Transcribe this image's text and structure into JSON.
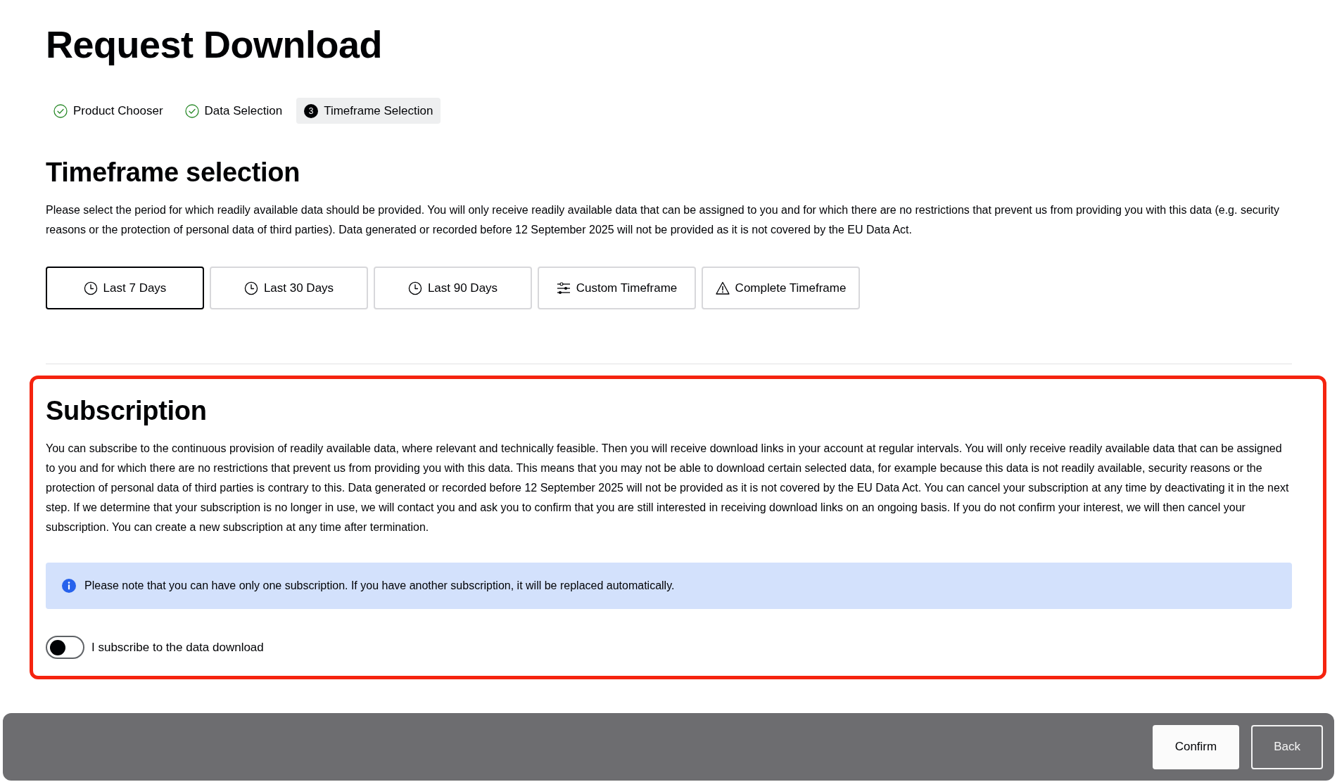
{
  "page_title": "Request Download",
  "steps": [
    {
      "label": "Product Chooser",
      "complete": true,
      "selected": false
    },
    {
      "label": "Data Selection",
      "complete": true,
      "selected": false
    },
    {
      "label": "Timeframe Selection",
      "number": "3",
      "complete": false,
      "selected": true
    }
  ],
  "timeframe_section": {
    "heading": "Timeframe selection",
    "description": "Please select the period for which readily available data should be provided. You will only receive readily available data that can be assigned to you and for which there are no restrictions that prevent us from providing you with this data (e.g. security reasons or the protection of personal data of third parties). Data generated or recorded before 12 September 2025 will not be provided as it is not covered by the EU Data Act.",
    "options": [
      {
        "label": "Last 7 Days",
        "kind": "preset",
        "selected": true
      },
      {
        "label": "Last 30 Days",
        "kind": "preset",
        "selected": false
      },
      {
        "label": "Last 90 Days",
        "kind": "preset",
        "selected": false
      },
      {
        "label": "Custom Timeframe",
        "kind": "custom",
        "selected": false
      },
      {
        "label": "Complete Timeframe",
        "kind": "complete",
        "selected": false
      }
    ]
  },
  "subscription_section": {
    "highlighted": true,
    "heading": "Subscription",
    "description": "You can subscribe to the continuous provision of readily available data, where relevant and technically feasible. Then you will receive download links in your account at regular intervals. You will only receive readily available data that can be assigned to you and for which there are no restrictions that prevent us from providing you with this data. This means that you may not be able to download certain selected data, for example because this data is not readily available, security reasons or the protection of personal data of third parties is contrary to this. Data generated or recorded before 12 September 2025 will not be provided as it is not covered by the EU Data Act. You can cancel your subscription at any time by deactivating it in the next step. If we determine that your subscription is no longer in use, we will contact you and ask you to confirm that you are still interested in receiving download links on an ongoing basis. If you do not confirm your interest, we will then cancel your subscription. You can create a new subscription at any time after termination.",
    "notice": {
      "kind": "info",
      "text": "Please note that you can have only one subscription. If you have another subscription, it will be replaced automatically."
    },
    "toggle": {
      "label": "I subscribe to the data download",
      "checked": false
    }
  },
  "footer": {
    "buttons": [
      {
        "label": "Confirm",
        "kind": "primary"
      },
      {
        "label": "Back",
        "kind": "secondary"
      }
    ]
  }
}
